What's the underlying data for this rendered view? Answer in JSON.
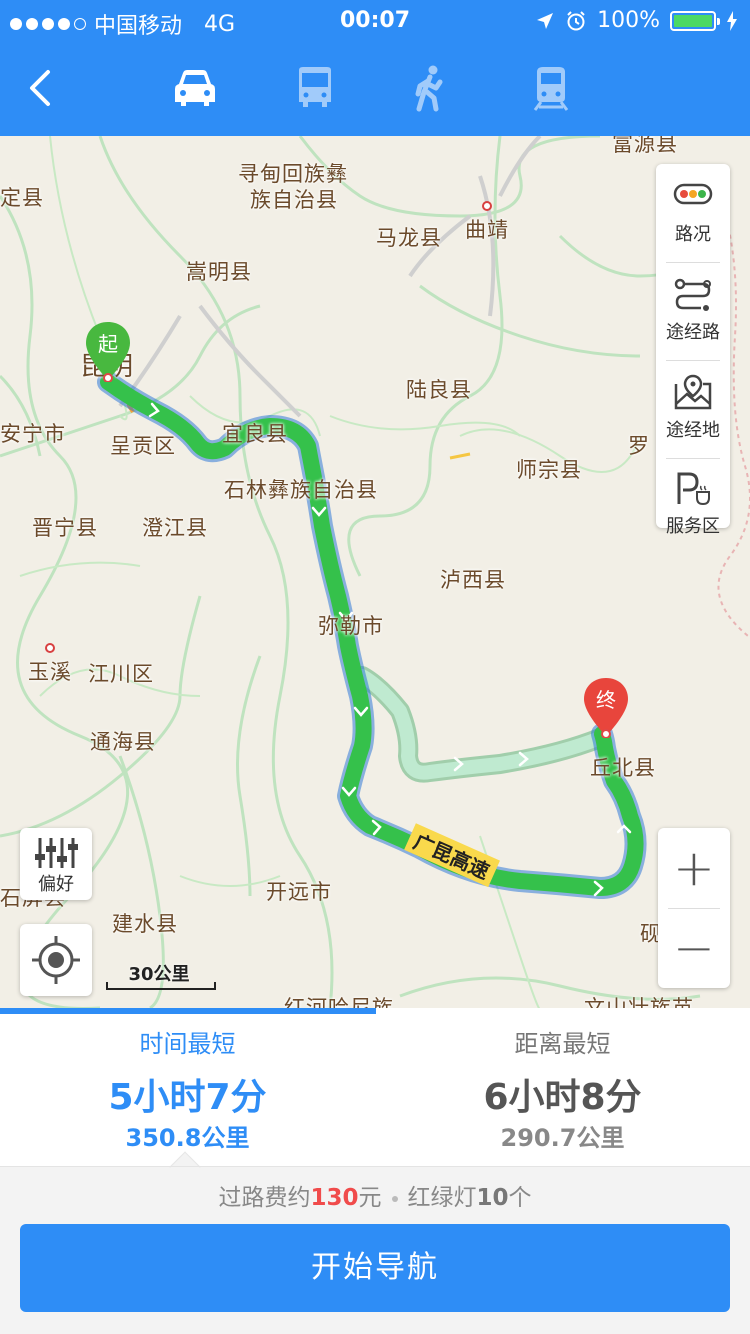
{
  "status_bar": {
    "carrier": "中国移动",
    "network": "4G",
    "time": "00:07",
    "battery": "100%"
  },
  "nav": {
    "modes": [
      {
        "name": "car",
        "active": true
      },
      {
        "name": "bus",
        "active": false
      },
      {
        "name": "walk",
        "active": false
      },
      {
        "name": "train",
        "active": false
      }
    ]
  },
  "map": {
    "labels": [
      "富源县",
      "定县",
      "寻甸回族彝",
      "族自治县",
      "马龙县",
      "曲靖",
      "嵩明县",
      "昆明",
      "陆良县",
      "安宁市",
      "呈贡区",
      "宜良县",
      "罗",
      "师宗县",
      "石林彝族自治县",
      "晋宁县",
      "澄江县",
      "泸西县",
      "弥勒市",
      "玉溪",
      "江川区",
      "丘北县",
      "通海县",
      "开远市",
      "石屏县",
      "建水县",
      "砚山县",
      "红河哈尼族",
      "文山壮族苗"
    ],
    "highway": "广昆高速",
    "start_pin": "起",
    "end_pin": "终",
    "side_panel": [
      {
        "label": "路况"
      },
      {
        "label": "途经路"
      },
      {
        "label": "途经地"
      },
      {
        "label": "服务区"
      }
    ],
    "pref_label": "偏好",
    "scale_label": "30公里",
    "zoom_in": "+",
    "zoom_out": "−"
  },
  "routes": [
    {
      "title": "时间最短",
      "time": "5小时7分",
      "distance": "350.8公里",
      "active": true
    },
    {
      "title": "距离最短",
      "time": "6小时8分",
      "distance": "290.7公里",
      "active": false
    }
  ],
  "info": {
    "toll_prefix": "过路费约",
    "toll_amount": "130",
    "toll_unit": "元",
    "lights_prefix": "红绿灯",
    "lights_count": "10",
    "lights_unit": "个"
  },
  "start_button": "开始导航",
  "colors": {
    "brand_blue": "#2e8df6",
    "route_green": "#35c14b",
    "alt_route": "#aee3c0",
    "toll_red": "#f04b4b"
  }
}
